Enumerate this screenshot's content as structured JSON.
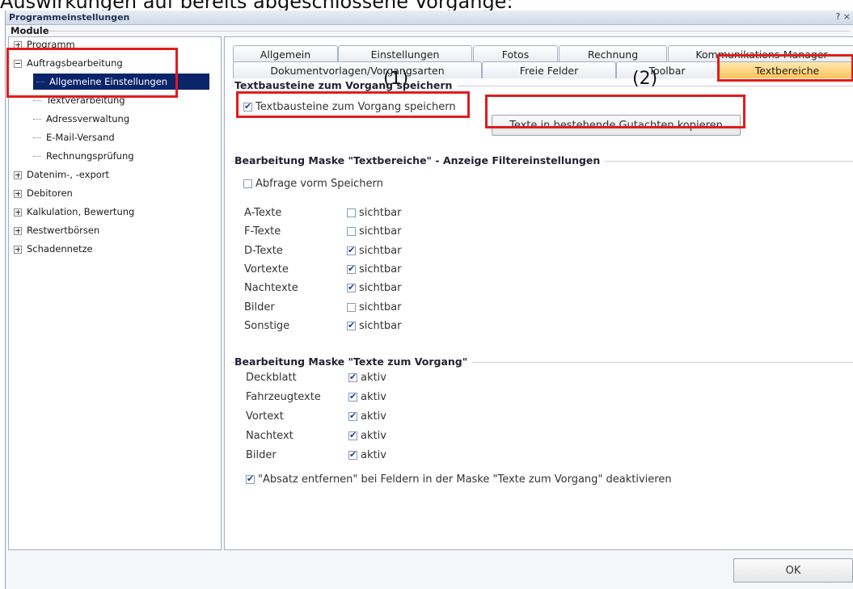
{
  "caption": "Auswirkungen auf bereits abgeschlossene Vorgänge:",
  "window": {
    "title": "Programmeinstellungen",
    "help": "? ×"
  },
  "module_label": "Module",
  "tree": {
    "items": [
      {
        "label": "Programm",
        "expander": "plus"
      },
      {
        "label": "Auftragsbearbeitung",
        "expander": "minus"
      },
      {
        "label": "Allgemeine Einstellungen",
        "child": true,
        "selected": true
      },
      {
        "label": "Textverarbeitung",
        "child": true
      },
      {
        "label": "Adressverwaltung",
        "child": true
      },
      {
        "label": "E-Mail-Versand",
        "child": true
      },
      {
        "label": "Rechnungsprüfung",
        "child": true
      },
      {
        "label": "Datenim-, -export",
        "expander": "plus"
      },
      {
        "label": "Debitoren",
        "expander": "plus"
      },
      {
        "label": "Kalkulation, Bewertung",
        "expander": "plus"
      },
      {
        "label": "Restwertbörsen",
        "expander": "plus"
      },
      {
        "label": "Schadennetze",
        "expander": "plus"
      }
    ]
  },
  "tabs_row1": [
    "Allgemein",
    "Einstellungen",
    "Fotos",
    "Rechnung",
    "Kommunikations-Manager"
  ],
  "tabs_row2": [
    "Dokumentvorlagen/Vorgangsarten",
    "Freie Felder",
    "Toolbar",
    "Textbereiche"
  ],
  "group1": {
    "title": "Textbausteine zum Vorgang speichern",
    "checkbox_label": "Textbausteine zum Vorgang speichern",
    "checked": true,
    "button": "Texte in bestehende Gutachten kopieren"
  },
  "group2": {
    "title": "Bearbeitung Maske \"Textbereiche\" - Anzeige Filtereinstellungen",
    "abfrage_label": "Abfrage vorm Speichern",
    "abfrage_checked": false,
    "rows": [
      {
        "label": "A-Texte",
        "value": "sichtbar",
        "checked": false
      },
      {
        "label": "F-Texte",
        "value": "sichtbar",
        "checked": false
      },
      {
        "label": "D-Texte",
        "value": "sichtbar",
        "checked": true
      },
      {
        "label": "Vortexte",
        "value": "sichtbar",
        "checked": true
      },
      {
        "label": "Nachtexte",
        "value": "sichtbar",
        "checked": true
      },
      {
        "label": "Bilder",
        "value": "sichtbar",
        "checked": false
      },
      {
        "label": "Sonstige",
        "value": "sichtbar",
        "checked": true
      }
    ]
  },
  "group3": {
    "title": "Bearbeitung Maske \"Texte zum Vorgang\"",
    "rows": [
      {
        "label": "Deckblatt",
        "value": "aktiv",
        "checked": true
      },
      {
        "label": "Fahrzeugtexte",
        "value": "aktiv",
        "checked": true
      },
      {
        "label": "Vortext",
        "value": "aktiv",
        "checked": true
      },
      {
        "label": "Nachtext",
        "value": "aktiv",
        "checked": true
      },
      {
        "label": "Bilder",
        "value": "aktiv",
        "checked": true
      }
    ],
    "absatz_label": "\"Absatz entfernen\" bei Feldern in der Maske \"Texte zum Vorgang\" deaktivieren",
    "absatz_checked": true
  },
  "annotations": [
    "(1)",
    "(2)"
  ],
  "ok_button": "OK",
  "colors": {
    "highlight": "#e41b1b",
    "selection": "#0a246a",
    "active_tab": "#ffc45a"
  }
}
